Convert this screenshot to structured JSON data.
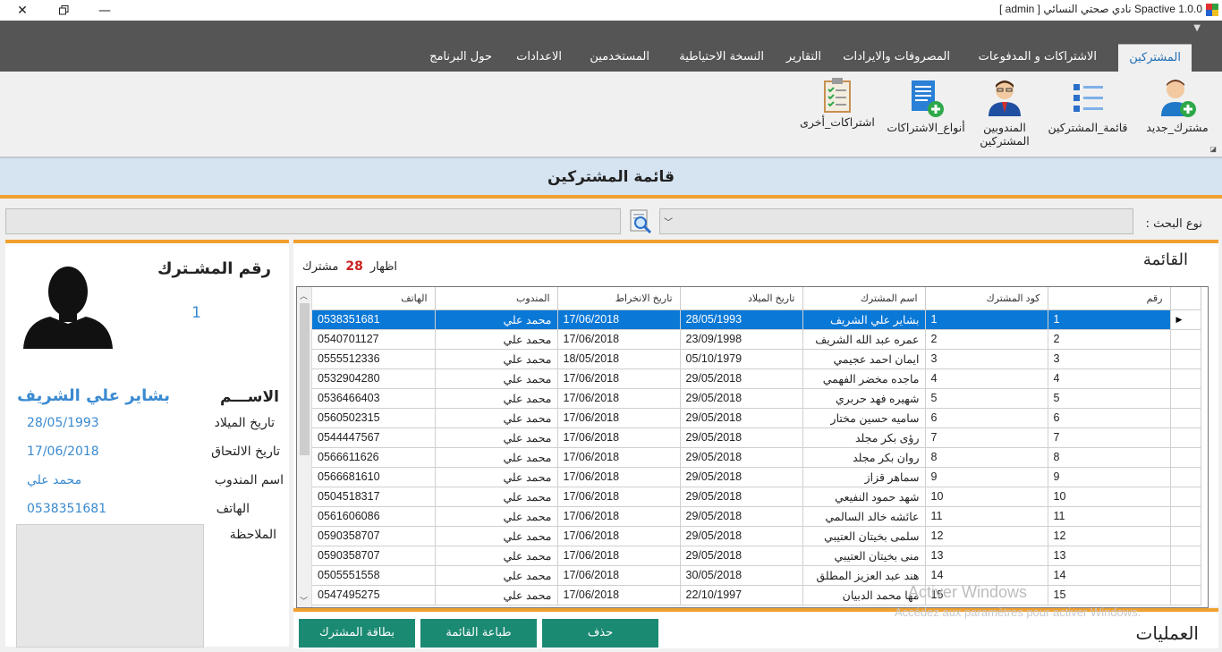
{
  "window": {
    "title": "Spactive 1.0.0 نادي صحتي النسائي [ admin ]"
  },
  "tabs": [
    {
      "label": "المشتركين",
      "active": true
    },
    {
      "label": "الاشتراكات و المدفوعات"
    },
    {
      "label": "المصروفات والايرادات"
    },
    {
      "label": "التقارير"
    },
    {
      "label": "النسخة الاحتياطية"
    },
    {
      "label": "المستخدمين"
    },
    {
      "label": "الاعدادات"
    },
    {
      "label": "حول البرنامج"
    }
  ],
  "ribbon": {
    "new_subscriber": "مشترك_جديد",
    "subscribers_list": "قائمة_المشتركين",
    "delegates_line1": "المندوبين",
    "delegates_line2": "المشتركين",
    "subscription_types": "أنواع_الاشتراكات",
    "other_subscriptions": "اشتراكات_أخرى"
  },
  "section_title": "قائمة المشتركين",
  "search": {
    "label": "نوع البحث :",
    "type_value": "",
    "query_value": ""
  },
  "details": {
    "title": "رقم المشـترك",
    "id": "1",
    "name_label": "الاســـم",
    "name": "بشاير علي الشريف",
    "birth_label": "تاريخ الميلاد",
    "birth": "28/05/1993",
    "join_label": "تاريخ الالتحاق",
    "join": "17/06/2018",
    "delegate_label": "اسم المندوب",
    "delegate": "محمد علي",
    "phone_label": "الهاتف",
    "phone": "0538351681",
    "note_label": "الملاحظة"
  },
  "list": {
    "title": "القائمة",
    "show_label": "اظهار",
    "count": "28",
    "unit": "مشترك",
    "columns": [
      "رقم",
      "كود المشترك",
      "اسم المشترك",
      "تاريخ الميلاد",
      "تاريخ الانخراط",
      "المندوب",
      "الهاتف"
    ],
    "rows": [
      [
        "1",
        "1",
        "بشاير علي الشريف",
        "28/05/1993",
        "17/06/2018",
        "محمد علي",
        "0538351681"
      ],
      [
        "2",
        "2",
        "عمره عبد الله الشريف",
        "23/09/1998",
        "17/06/2018",
        "محمد علي",
        "0540701127"
      ],
      [
        "3",
        "3",
        "ايمان احمد عجيمي",
        "05/10/1979",
        "18/05/2018",
        "محمد علي",
        "0555512336"
      ],
      [
        "4",
        "4",
        "ماجده مخضر الفهمي",
        "29/05/2018",
        "17/06/2018",
        "محمد علي",
        "0532904280"
      ],
      [
        "5",
        "5",
        "شهيره فهد حربري",
        "29/05/2018",
        "17/06/2018",
        "محمد علي",
        "0536466403"
      ],
      [
        "6",
        "6",
        "ساميه حسين مختار",
        "29/05/2018",
        "17/06/2018",
        "محمد علي",
        "0560502315"
      ],
      [
        "7",
        "7",
        "رؤى بكر مجلد",
        "29/05/2018",
        "17/06/2018",
        "محمد علي",
        "0544447567"
      ],
      [
        "8",
        "8",
        "روان بكر مجلد",
        "29/05/2018",
        "17/06/2018",
        "محمد علي",
        "0566611626"
      ],
      [
        "9",
        "9",
        "سماهر قزاز",
        "29/05/2018",
        "17/06/2018",
        "محمد علي",
        "0566681610"
      ],
      [
        "10",
        "10",
        "شهد حمود النفيعي",
        "29/05/2018",
        "17/06/2018",
        "محمد علي",
        "0504518317"
      ],
      [
        "11",
        "11",
        "عائشه خالد السالمي",
        "29/05/2018",
        "17/06/2018",
        "محمد علي",
        "0561606086"
      ],
      [
        "12",
        "12",
        "سلمى بخيتان العتيبي",
        "29/05/2018",
        "17/06/2018",
        "محمد علي",
        "0590358707"
      ],
      [
        "13",
        "13",
        "منى بخيتان العتيبي",
        "29/05/2018",
        "17/06/2018",
        "محمد علي",
        "0590358707"
      ],
      [
        "14",
        "14",
        "هند عبد العزيز المطلق",
        "30/05/2018",
        "17/06/2018",
        "محمد علي",
        "0505551558"
      ],
      [
        "15",
        "15",
        "مها محمد الدبيان",
        "22/10/1997",
        "17/06/2018",
        "محمد علي",
        "0547495275"
      ]
    ]
  },
  "operations": {
    "title": "العمليات",
    "card_btn": "بطاقة المشترك",
    "print_btn": "طباعة القائمة",
    "delete_btn": "حذف"
  },
  "watermark": {
    "line1": "Activer Windows",
    "line2": "Accédez aux paramètres pour activer Windows."
  },
  "colors": {
    "accent": "#f0a030",
    "selection": "#0a78d7",
    "button": "#1b8a72",
    "link_value": "#3a8ad0"
  }
}
